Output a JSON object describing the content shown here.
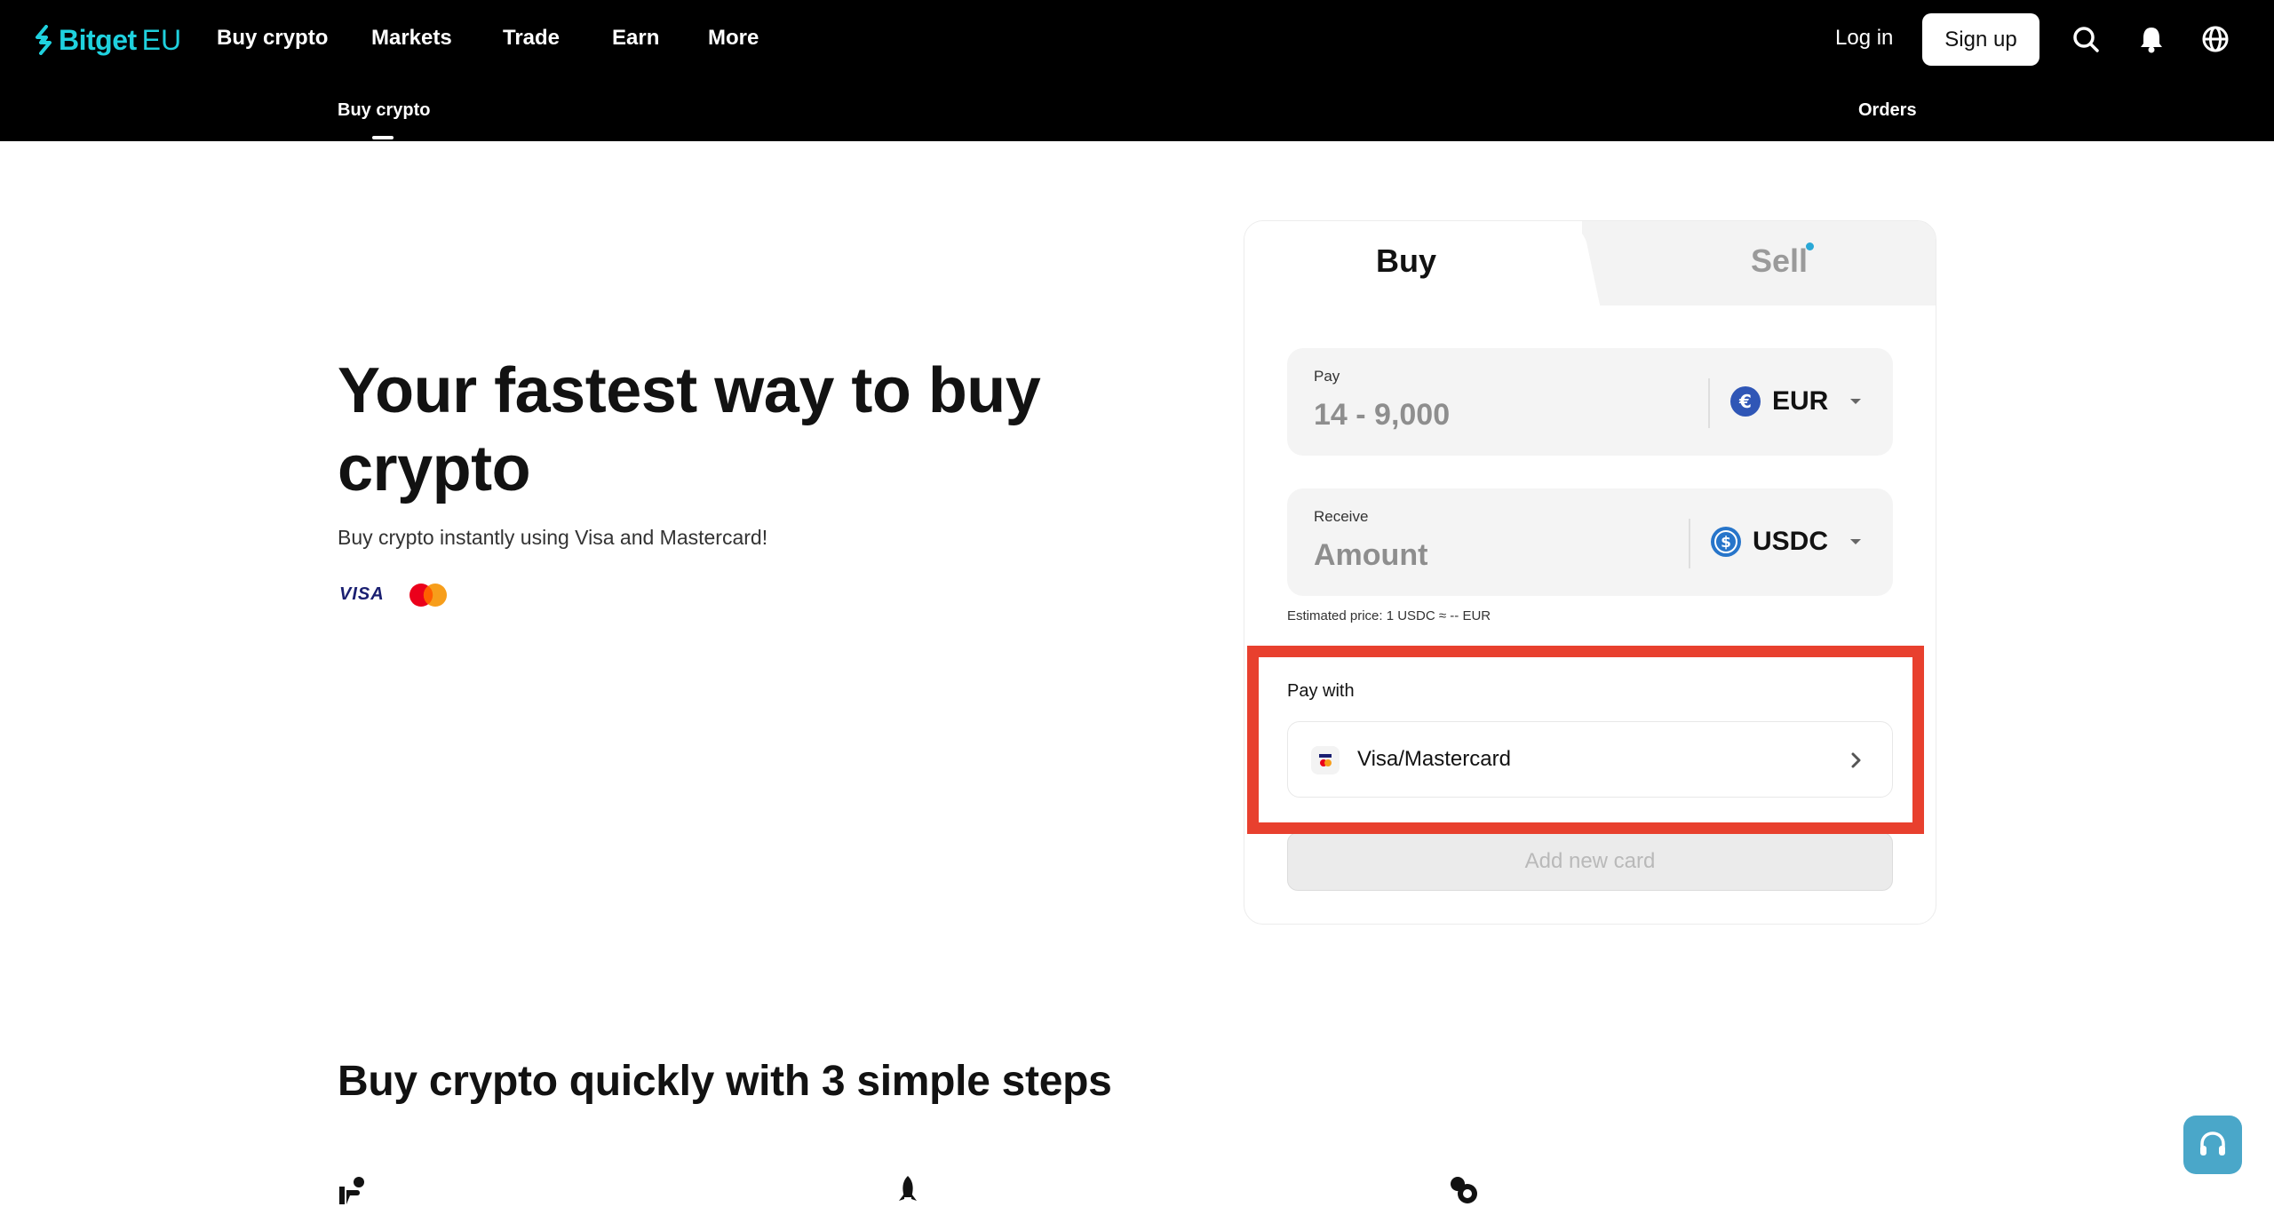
{
  "header": {
    "logo_text": "Bitget",
    "logo_suffix": "EU",
    "nav": [
      "Buy crypto",
      "Markets",
      "Trade",
      "Earn",
      "More"
    ],
    "login_label": "Log in",
    "signup_label": "Sign up",
    "icons": [
      "search-icon",
      "bell-icon",
      "globe-icon"
    ]
  },
  "subnav": {
    "active": "Buy crypto",
    "orders": "Orders"
  },
  "hero": {
    "title": "Your fastest way to buy crypto",
    "subtitle": "Buy crypto instantly using Visa and Mastercard!",
    "visa_text": "VISA"
  },
  "widget": {
    "tabs": {
      "buy": "Buy",
      "sell": "Sell"
    },
    "pay": {
      "label": "Pay",
      "placeholder": "14 - 9,000",
      "currency": "EUR"
    },
    "receive": {
      "label": "Receive",
      "placeholder": "Amount",
      "currency": "USDC"
    },
    "estimated_price": "Estimated price: 1 USDC ≈ -- EUR",
    "pay_with_label": "Pay with",
    "payment_method": "Visa/Mastercard",
    "add_card_label": "Add new card"
  },
  "steps": {
    "title": "Buy crypto quickly with 3 simple steps"
  },
  "colors": {
    "brand": "#1fd1de",
    "highlight": "#e8402e",
    "support": "#4aa7c9"
  }
}
